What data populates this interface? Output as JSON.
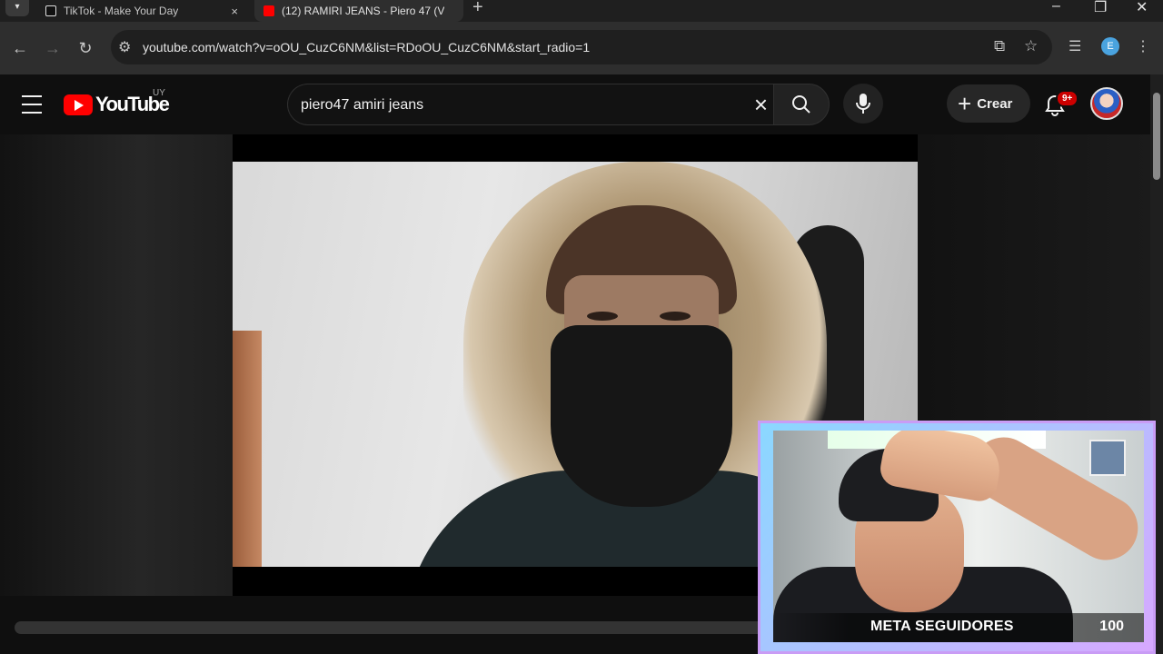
{
  "browser": {
    "tabs": [
      {
        "title": "TikTok - Make Your Day",
        "active": false
      },
      {
        "title": "(12) RAMIRI JEANS - Piero 47 (V",
        "active": true
      }
    ],
    "close_glyph": "×",
    "new_tab_glyph": "+",
    "address": "youtube.com/watch?v=oOU_CuzC6NM&list=RDoOU_CuzC6NM&start_radio=1",
    "profile_initial": "E",
    "icons": [
      "back-icon",
      "forward-icon",
      "reload-icon",
      "site-settings-icon",
      "install-app-icon",
      "bookmark-star-icon",
      "extensions-icon",
      "more-icon"
    ]
  },
  "youtube": {
    "logo_text": "YouTube",
    "country_code": "UY",
    "search_query": "piero47 amiri jeans",
    "clear_glyph": "×",
    "create_label": "Crear",
    "create_plus": "+",
    "notification_badge": "9+"
  },
  "webcam": {
    "label": "META SEGUIDORES",
    "count": "100",
    "border_color": "#c99cf5"
  },
  "colors": {
    "youtube_red": "#ff0000",
    "badge_red": "#cc0000",
    "background": "#0f0f0f"
  }
}
